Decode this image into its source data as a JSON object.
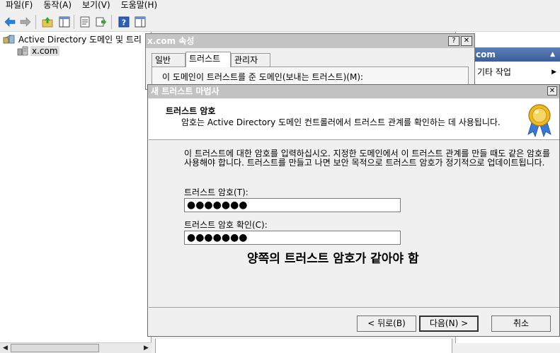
{
  "menu": [
    "파일(F)",
    "동작(A)",
    "보기(V)",
    "도움말(H)"
  ],
  "toolbar_icons": [
    "back-arrow-icon",
    "forward-arrow-icon",
    "up-folder-icon",
    "console-tree-icon",
    "properties-icon",
    "export-icon",
    "help-icon",
    "action-pane-icon"
  ],
  "tree": {
    "root_label": "Active Directory 도메인 및 트리",
    "child_label": "x.com"
  },
  "actions_pane": {
    "header": "com",
    "item": "기타 작업"
  },
  "properties_dialog": {
    "title": "x.com 속성",
    "help": "?",
    "close": "✕",
    "tabs": [
      "일반",
      "트러스트",
      "관리자"
    ],
    "active_tab": "트러스트",
    "section_label": "이 도메인이 트러스트를 준 도메인(보내는 트러스트)(M):"
  },
  "wizard": {
    "title": "새 트러스트 마법사",
    "close": "✕",
    "heading": "트러스트 암호",
    "subheading": "암호는 Active Directory 도메인 컨트롤러에서 트러스트 관계를 확인하는 데 사용됩니다.",
    "description": "이 트러스트에 대한 암호를 입력하십시오. 지정한 도메인에서 이 트러스트 관계를 만들 때도 같은 암호를 사용해야 합니다. 트러스트를 만들고 나면 보안 목적으로 트러스트 암호가 정기적으로 업데이트됩니다.",
    "password_label": "트러스트 암호(T):",
    "password_value": "●●●●●●●",
    "confirm_label": "트러스트 암호 확인(C):",
    "confirm_value": "●●●●●●●",
    "note": "양쪽의 트러스트 암호가 같아야 함",
    "back_button": "< 뒤로(B)",
    "next_button": "다음(N) >",
    "cancel_button": "취소"
  },
  "colors": {
    "actions_header": "#3b5d9b",
    "inactive_title": "#c2c2c2"
  }
}
